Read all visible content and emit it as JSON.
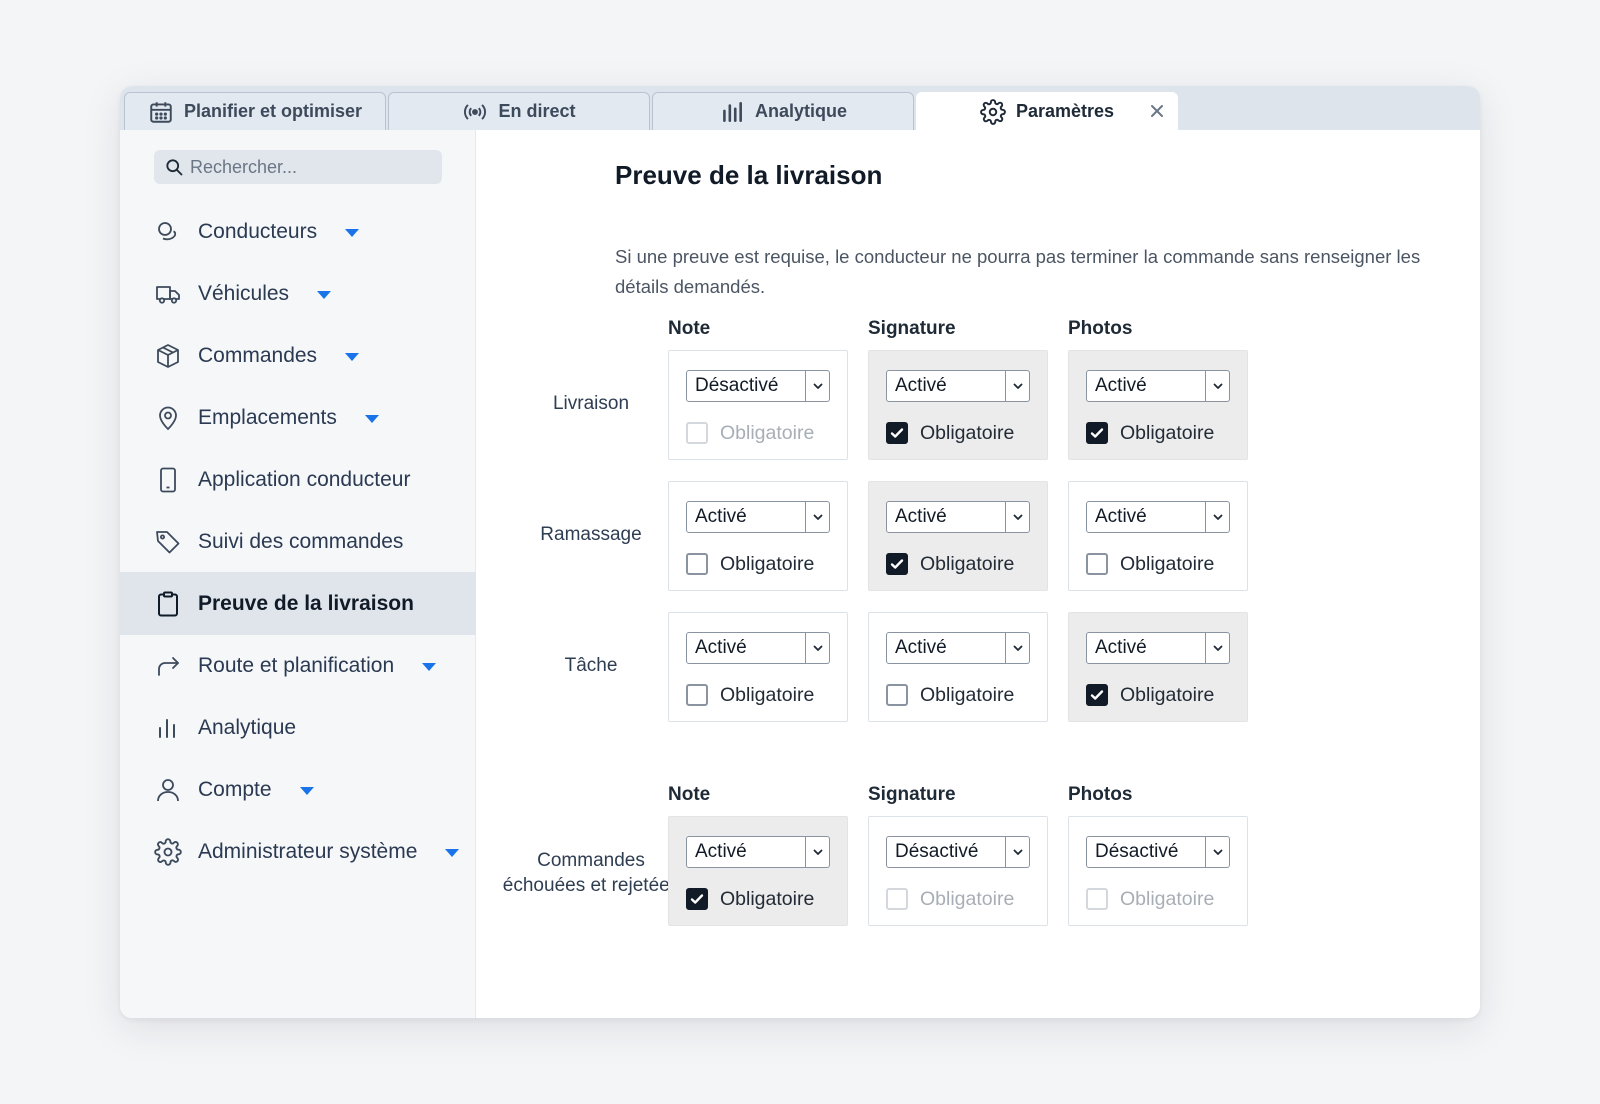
{
  "tabs": [
    {
      "label": "Planifier et optimiser",
      "icon": "calendar-icon"
    },
    {
      "label": "En direct",
      "icon": "broadcast-icon"
    },
    {
      "label": "Analytique",
      "icon": "bar-chart-icon"
    },
    {
      "label": "Paramètres",
      "icon": "gear-icon",
      "active": true
    }
  ],
  "sidebar": {
    "search_placeholder": "Rechercher...",
    "items": [
      {
        "label": "Conducteurs",
        "icon": "drivers-icon",
        "expandable": true
      },
      {
        "label": "Véhicules",
        "icon": "truck-icon",
        "expandable": true
      },
      {
        "label": "Commandes",
        "icon": "box-icon",
        "expandable": true
      },
      {
        "label": "Emplacements",
        "icon": "location-pin-icon",
        "expandable": true
      },
      {
        "label": "Application conducteur",
        "icon": "phone-icon",
        "expandable": false
      },
      {
        "label": "Suivi des commandes",
        "icon": "tag-icon",
        "expandable": false
      },
      {
        "label": "Preuve de la livraison",
        "icon": "clipboard-icon",
        "expandable": false,
        "active": true
      },
      {
        "label": "Route et planification",
        "icon": "route-arrow-icon",
        "expandable": true
      },
      {
        "label": "Analytique",
        "icon": "bar-chart-icon",
        "expandable": false
      },
      {
        "label": "Compte",
        "icon": "user-icon",
        "expandable": true
      },
      {
        "label": "Administrateur système",
        "icon": "gear-icon",
        "expandable": true
      }
    ]
  },
  "main": {
    "title": "Preuve de la livraison",
    "description": "Si une preuve est requise, le conducteur ne pourra pas terminer la commande sans renseigner les détails demandés.",
    "checkbox_label": "Obligatoire",
    "columns": [
      "Note",
      "Signature",
      "Photos"
    ],
    "table1": {
      "rows": [
        {
          "label": "Livraison",
          "cells": [
            {
              "value": "Désactivé",
              "required": false,
              "shaded": false,
              "disabled": true
            },
            {
              "value": "Activé",
              "required": true,
              "shaded": true,
              "disabled": false
            },
            {
              "value": "Activé",
              "required": true,
              "shaded": true,
              "disabled": false
            }
          ]
        },
        {
          "label": "Ramassage",
          "cells": [
            {
              "value": "Activé",
              "required": false,
              "shaded": false,
              "disabled": false
            },
            {
              "value": "Activé",
              "required": true,
              "shaded": true,
              "disabled": false
            },
            {
              "value": "Activé",
              "required": false,
              "shaded": false,
              "disabled": false
            }
          ]
        },
        {
          "label": "Tâche",
          "cells": [
            {
              "value": "Activé",
              "required": false,
              "shaded": false,
              "disabled": false
            },
            {
              "value": "Activé",
              "required": false,
              "shaded": false,
              "disabled": false
            },
            {
              "value": "Activé",
              "required": true,
              "shaded": true,
              "disabled": false
            }
          ]
        }
      ]
    },
    "table2": {
      "rows": [
        {
          "label_lines": [
            "Commandes",
            "échouées et rejetées"
          ],
          "cells": [
            {
              "value": "Activé",
              "required": true,
              "shaded": true,
              "disabled": false
            },
            {
              "value": "Désactivé",
              "required": false,
              "shaded": false,
              "disabled": true
            },
            {
              "value": "Désactivé",
              "required": false,
              "shaded": false,
              "disabled": true
            }
          ]
        }
      ]
    }
  }
}
